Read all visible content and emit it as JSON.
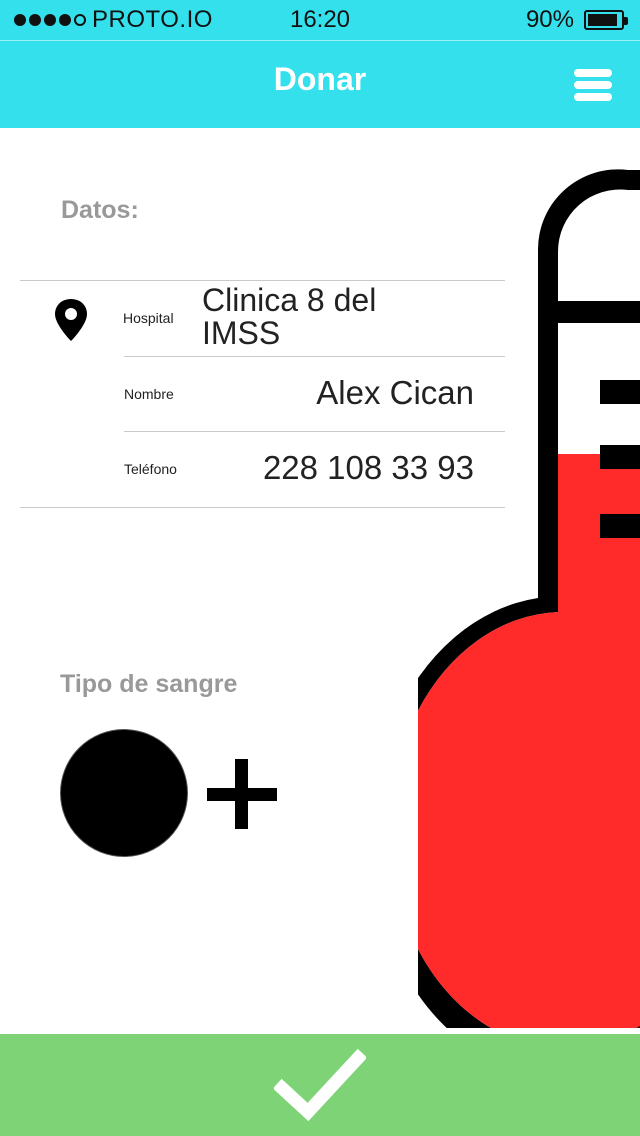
{
  "status_bar": {
    "carrier": "PROTO.IO",
    "time": "16:20",
    "battery_percent": "90%",
    "battery_level": 0.9,
    "signal_dots_filled": 4,
    "signal_dots_total": 5
  },
  "header": {
    "title": "Donar",
    "menu_icon": "hamburger-menu-icon",
    "background_color": "#33e0ec"
  },
  "datos": {
    "label": "Datos:",
    "hospital": {
      "label": "Hospital",
      "value": "Clinica 8 del IMSS",
      "icon": "location-pin-icon"
    },
    "nombre": {
      "label": "Nombre",
      "value": "Alex Cican"
    },
    "telefono": {
      "label": "Teléfono",
      "value": "228 108 33 93"
    }
  },
  "blood_type": {
    "label": "Tipo de sangre",
    "group_icon": "black-circle-icon",
    "rh_icon": "plus-icon"
  },
  "thermometer": {
    "icon": "thermometer-icon",
    "fill_color": "#ff2a2a",
    "fill_level": 0.5
  },
  "confirm": {
    "icon": "checkmark-icon",
    "background_color": "#7ed376"
  }
}
